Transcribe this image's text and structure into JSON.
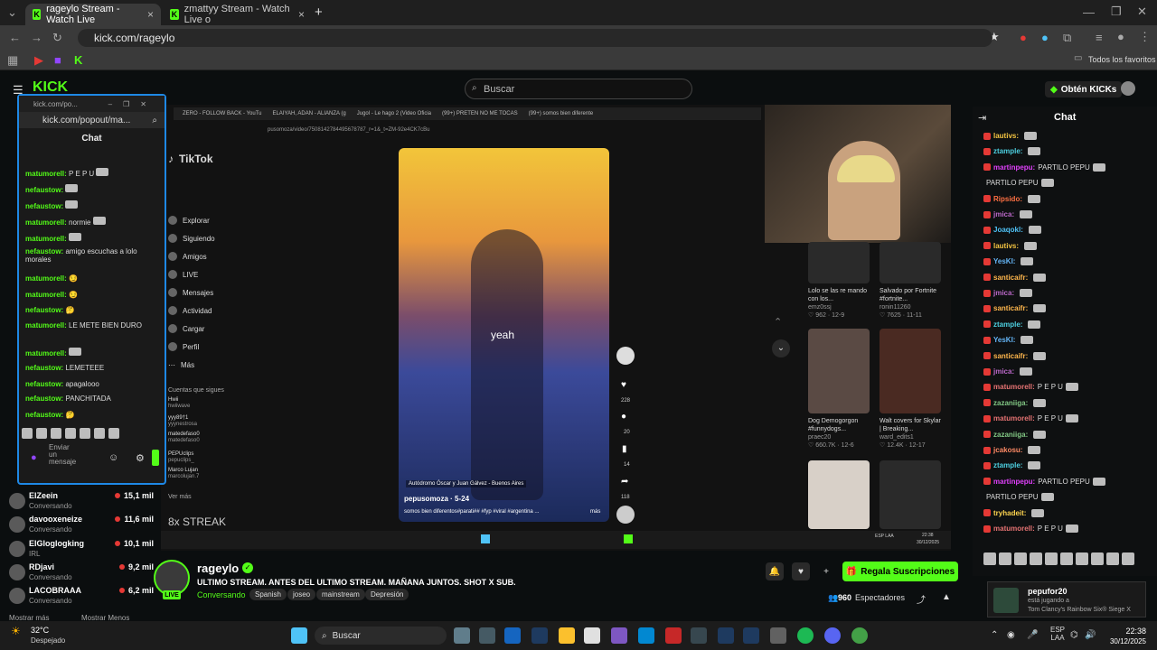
{
  "browser": {
    "tabs": [
      {
        "title": "rageylo Stream - Watch Live"
      },
      {
        "title": "zmattyy Stream - Watch Live o"
      }
    ],
    "url": "kick.com/rageylo",
    "bookmarks_label": "Todos los favoritos"
  },
  "kick": {
    "logo": "KICK",
    "search_placeholder": "Buscar",
    "get_kicks": "Obtén KICKs"
  },
  "popout": {
    "title": "kick.com/po...",
    "url": "kick.com/popout/ma...",
    "chat_title": "Chat",
    "input_placeholder": "Enviar un mensaje",
    "messages": [
      {
        "user": "matumorell:",
        "text": "P E P U"
      },
      {
        "user": "nefaustow:",
        "text": ""
      },
      {
        "user": "nefaustow:",
        "text": ""
      },
      {
        "user": "matumorell:",
        "text": "normie"
      },
      {
        "user": "matumorell:",
        "text": ""
      },
      {
        "user": "nefaustow:",
        "text": "amigo escuchas a lolo morales"
      },
      {
        "user": "matumorell:",
        "text": ""
      },
      {
        "user": "matumorell:",
        "text": ""
      },
      {
        "user": "nefaustow:",
        "text": ""
      },
      {
        "user": "matumorell:",
        "text": "LE METE BIEN DURO"
      },
      {
        "user": "matumorell:",
        "text": ""
      },
      {
        "user": "nefaustow:",
        "text": "LEMETEEE"
      },
      {
        "user": "nefaustow:",
        "text": "apagalooo"
      },
      {
        "user": "nefaustow:",
        "text": "PANCHITADA"
      },
      {
        "user": "nefaustow:",
        "text": ""
      }
    ]
  },
  "stream_screen": {
    "inner_tabs": [
      "ZERO - FOLLOW BACK - YouTu",
      "ELAIYAH, ADAN - ALIANZA (g",
      "Jugol - Le hago 2 (Video Oficia",
      "(99+) PRETEN NO ME TOCAS",
      "(99+) somos bien diferente"
    ],
    "inner_url": "pusomoza/video/7508142784495678787_r=1&_t=ZM-92e4CK7cBu",
    "tiktok_label": "TikTok",
    "tiktok_nav": [
      "Explorar",
      "Siguiendo",
      "Amigos",
      "LIVE",
      "Mensajes",
      "Actividad",
      "Cargar",
      "Perfil",
      "Más"
    ],
    "following_header": "Cuentas que sigues",
    "following": [
      {
        "name": "Hwii",
        "handle": "hwiiwave"
      },
      {
        "name": "yyy89†1",
        "handle": "yyynestrosa"
      },
      {
        "name": "matedefaso0",
        "handle": "matedefaso0"
      },
      {
        "name": "PEPUclips",
        "handle": "pepuclips_"
      },
      {
        "name": "Marco Lujan",
        "handle": "marcolujan.7"
      }
    ],
    "see_more": "Ver más",
    "streak": "8x STREAK",
    "video_caption": "yeah",
    "video_location": "Autódromo Óscar y Juan Gálvez - Buenos Aires",
    "video_author": "pepusomoza · 5-24",
    "video_desc": "somos bien diferentos#parati## #fyp #viral #argentina ...",
    "video_more": "más",
    "counts": {
      "likes": "228",
      "comments": "20",
      "saves": "14",
      "shares": "118"
    },
    "recs": [
      {
        "title": "Lolo se las re mando con los...",
        "author": "emz0ssj",
        "stats": "♡ 962 · 12-9"
      },
      {
        "title": "Salvado por Fortnite #fortnite...",
        "author": "ronin11260",
        "stats": "♡ 7625 · 11-11"
      },
      {
        "title": "Dog Demogorgon #funnydogs...",
        "author": "praec20",
        "stats": "♡ 660.7K · 12-6"
      },
      {
        "title": "Walt covers for Skylar | Breaking...",
        "author": "ward_edits1",
        "stats": "♡ 12.4K · 12-17"
      }
    ],
    "inner_clock": {
      "lang": "ESP LAA",
      "time": "22:38",
      "date": "30/12/2025"
    }
  },
  "channels": [
    {
      "name": "ElZeein",
      "category": "Conversando",
      "viewers": "15,1 mil"
    },
    {
      "name": "davooxeneize",
      "category": "Conversando",
      "viewers": "11,6 mil"
    },
    {
      "name": "ElGloglogking",
      "category": "IRL",
      "viewers": "10,1 mil"
    },
    {
      "name": "RDjavi",
      "category": "Conversando",
      "viewers": "9,2 mil"
    },
    {
      "name": "LACOBRAAA",
      "category": "Conversando",
      "viewers": "6,2 mil"
    }
  ],
  "channels_more": "Mostrar más",
  "channels_less": "Mostrar Menos",
  "streamer": {
    "name": "rageylo",
    "title": "ULTIMO STREAM. ANTES DEL ULTIMO STREAM. MAÑANA JUNTOS. SHOT X SUB.",
    "category": "Conversando",
    "tags": [
      "Spanish",
      "joseo",
      "mainstream",
      "Depresión"
    ],
    "live": "LIVE",
    "viewers_count": "960",
    "viewers_label": "Espectadores",
    "gift_subs": "Regala Suscripciones"
  },
  "chat": {
    "title": "Chat",
    "messages": [
      {
        "user": "lautivs:",
        "text": "",
        "color": "#f5c542"
      },
      {
        "user": "ztample:",
        "text": "",
        "color": "#4dd0e1"
      },
      {
        "user": "martinpepu:",
        "text": "PARTILO PEPU",
        "color": "#e040fb"
      },
      {
        "user": "",
        "text": "PARTILO PEPU",
        "color": "#ffffff"
      },
      {
        "user": "Ripsido:",
        "text": "",
        "color": "#ff7043"
      },
      {
        "user": "jmica:",
        "text": "",
        "color": "#ba68c8"
      },
      {
        "user": "Joaqokl:",
        "text": "",
        "color": "#4fc3f7"
      },
      {
        "user": "lautivs:",
        "text": "",
        "color": "#f5c542"
      },
      {
        "user": "YesKI:",
        "text": "",
        "color": "#64b5f6"
      },
      {
        "user": "santicaifr:",
        "text": "",
        "color": "#ffb74d"
      },
      {
        "user": "jmica:",
        "text": "",
        "color": "#ba68c8"
      },
      {
        "user": "santicaifr:",
        "text": "",
        "color": "#ffb74d"
      },
      {
        "user": "ztample:",
        "text": "",
        "color": "#4dd0e1"
      },
      {
        "user": "YesKI:",
        "text": "",
        "color": "#64b5f6"
      },
      {
        "user": "santicaifr:",
        "text": "",
        "color": "#ffb74d"
      },
      {
        "user": "jmica:",
        "text": "",
        "color": "#ba68c8"
      },
      {
        "user": "matumorell:",
        "text": "P E P U",
        "color": "#e57373"
      },
      {
        "user": "zazaniiga:",
        "text": "",
        "color": "#81c784"
      },
      {
        "user": "matumorell:",
        "text": "P E P U",
        "color": "#e57373"
      },
      {
        "user": "zazaniiga:",
        "text": "",
        "color": "#81c784"
      },
      {
        "user": "jcakosu:",
        "text": "",
        "color": "#ff8a65"
      },
      {
        "user": "ztample:",
        "text": "",
        "color": "#4dd0e1"
      },
      {
        "user": "martinpepu:",
        "text": "PARTILO PEPU",
        "color": "#e040fb"
      },
      {
        "user": "",
        "text": "PARTILO PEPU",
        "color": "#ffffff"
      },
      {
        "user": "tryhadeit:",
        "text": "",
        "color": "#ffd54f"
      },
      {
        "user": "matumorell:",
        "text": "P E P U",
        "color": "#e57373"
      }
    ],
    "notif_name": "pepufor20",
    "notif_status": "está jugando a",
    "notif_game": "Tom Clancy's Rainbow Six® Siege X"
  },
  "taskbar": {
    "weather_temp": "32°C",
    "weather_desc": "Despejado",
    "search_label": "Buscar",
    "lang": "ESP LAA",
    "time": "22:38",
    "date": "30/12/2025"
  },
  "colors": {
    "kick_green": "#53fc18",
    "popout_border": "#1e88e5"
  }
}
